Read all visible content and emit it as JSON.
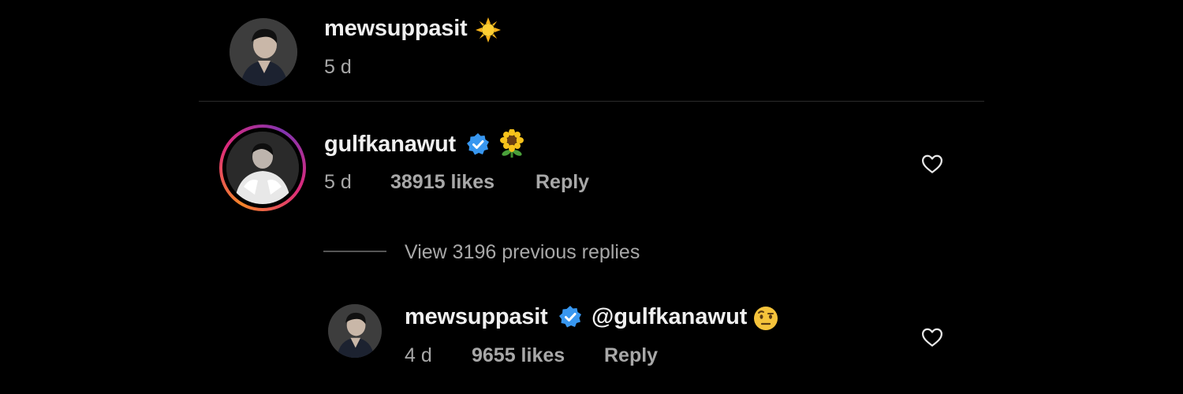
{
  "comments": [
    {
      "username": "mewsuppasit",
      "verified": false,
      "emoji": "sun-emoji",
      "time": "5 d"
    },
    {
      "username": "gulfkanawut",
      "verified": true,
      "emoji": "sunflower-emoji",
      "time": "5 d",
      "likes": "38915 likes",
      "reply_label": "Reply",
      "story_ring": true
    }
  ],
  "view_replies": "View 3196 previous replies",
  "reply": {
    "username": "mewsuppasit",
    "verified": true,
    "mention": "@gulfkanawut",
    "emoji": "raised-eyebrow-face-emoji",
    "time": "4 d",
    "likes": "9655 likes",
    "reply_label": "Reply"
  },
  "colors": {
    "background": "#000000",
    "verified_badge": "#3897f0",
    "secondary_text": "#a8a8a8"
  }
}
